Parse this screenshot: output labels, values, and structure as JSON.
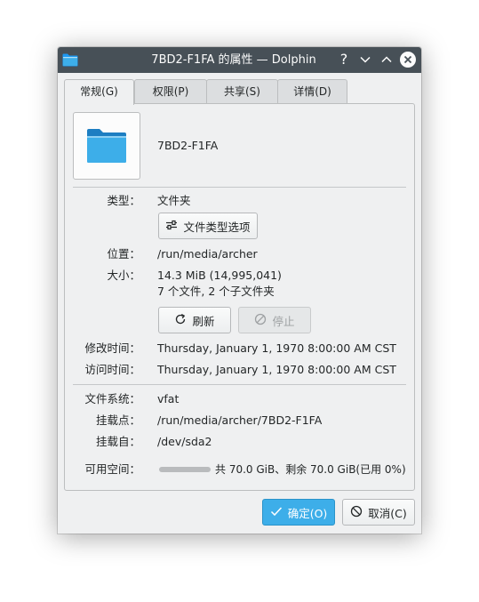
{
  "window": {
    "title": "7BD2-F1FA 的属性 — Dolphin",
    "help_glyph": "?",
    "icons": {
      "app": "folder-icon",
      "help": "help-icon",
      "minimize": "minimize-icon",
      "maximize": "maximize-icon",
      "close": "close-icon"
    }
  },
  "tabs": [
    {
      "label": "常规(G)",
      "active": true
    },
    {
      "label": "权限(P)",
      "active": false
    },
    {
      "label": "共享(S)",
      "active": false
    },
    {
      "label": "详情(D)",
      "active": false
    }
  ],
  "general": {
    "name": "7BD2-F1FA",
    "icon": "folder-icon",
    "type_label": "类型：",
    "type_value": "文件夹",
    "type_options_button": "文件类型选项",
    "location_label": "位置：",
    "location_value": "/run/media/archer",
    "size_label": "大小：",
    "size_value": "14.3 MiB (14,995,041)",
    "contents_value": "7 个文件, 2 个子文件夹",
    "refresh_button": "刷新",
    "stop_button": "停止",
    "modified_label": "修改时间：",
    "modified_value": "Thursday, January 1, 1970 8:00:00 AM CST",
    "accessed_label": "访问时间：",
    "accessed_value": "Thursday, January 1, 1970 8:00:00 AM CST",
    "filesystem_label": "文件系统：",
    "filesystem_value": "vfat",
    "mountpoint_label": "挂载点：",
    "mountpoint_value": "/run/media/archer/7BD2-F1FA",
    "mountedfrom_label": "挂载自：",
    "mountedfrom_value": "/dev/sda2",
    "freespace_label": "可用空间：",
    "freespace_value": "共 70.0 GiB、剩余 70.0 GiB(已用 0%)",
    "used_fraction": 0
  },
  "footer": {
    "ok_button": "确定(O)",
    "cancel_button": "取消(C)"
  },
  "colors": {
    "titlebar": "#475057",
    "window_bg": "#eff0f1",
    "accent": "#3daee9",
    "folder": "#3daee9"
  }
}
